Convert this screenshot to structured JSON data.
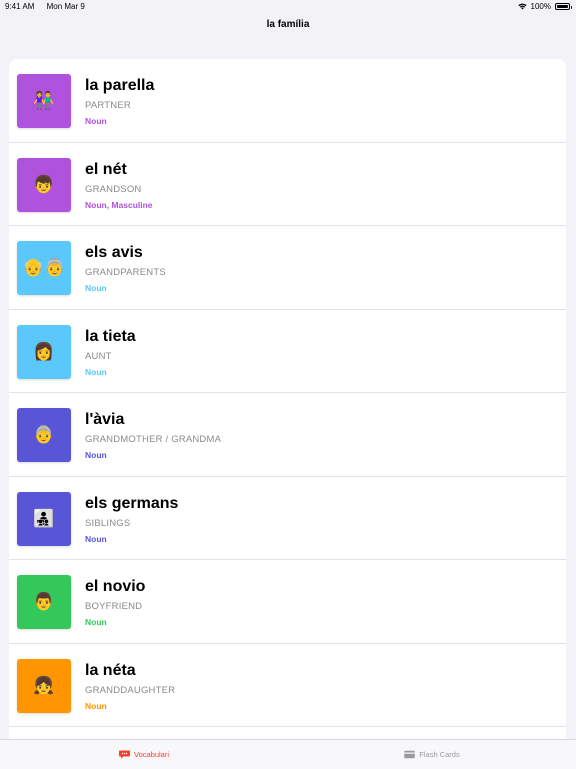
{
  "status": {
    "time": "9:41 AM",
    "date": "Mon Mar 9",
    "battery": "100%",
    "battery_level": 1.0
  },
  "nav": {
    "title": "la família"
  },
  "items": [
    {
      "word": "la parella",
      "translation": "PARTNER",
      "pos": "Noun",
      "emoji": "👫",
      "color": "#af52de",
      "pos_color": "#af52de"
    },
    {
      "word": "el nét",
      "translation": "GRANDSON",
      "pos": "Noun, Masculine",
      "emoji": "👦",
      "color": "#af52de",
      "pos_color": "#af52de"
    },
    {
      "word": "els avis",
      "translation": "GRANDPARENTS",
      "pos": "Noun",
      "emoji": "👴👵",
      "color": "#5ac8fa",
      "pos_color": "#5ac8fa"
    },
    {
      "word": "la tieta",
      "translation": "AUNT",
      "pos": "Noun",
      "emoji": "👩",
      "color": "#5ac8fa",
      "pos_color": "#5ac8fa"
    },
    {
      "word": "l'àvia",
      "translation": "GRANDMOTHER / GRANDMA",
      "pos": "Noun",
      "emoji": "👵",
      "color": "#5856d6",
      "pos_color": "#5856d6"
    },
    {
      "word": "els germans",
      "translation": "SIBLINGS",
      "pos": "Noun",
      "emoji": "👨‍👧‍👦",
      "color": "#5856d6",
      "pos_color": "#5856d6"
    },
    {
      "word": "el novio",
      "translation": "BOYFRIEND",
      "pos": "Noun",
      "emoji": "👨",
      "color": "#34c759",
      "pos_color": "#34c759"
    },
    {
      "word": "la néta",
      "translation": "GRANDDAUGHTER",
      "pos": "Noun",
      "emoji": "👧",
      "color": "#ff9500",
      "pos_color": "#ff9500"
    }
  ],
  "tabs": [
    {
      "label": "Vocabulari",
      "icon": "speech-bubble-icon",
      "active": true
    },
    {
      "label": "Flash Cards",
      "icon": "card-icon",
      "active": false
    }
  ]
}
